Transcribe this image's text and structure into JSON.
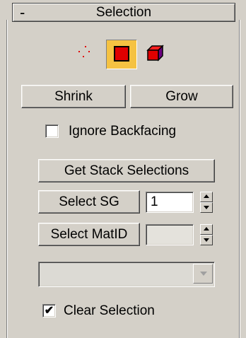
{
  "rollout": {
    "title": "Selection",
    "collapse_glyph": "-"
  },
  "selection_modes": [
    {
      "name": "vertex-mode-icon",
      "icon": "red-dots-vertex-icon",
      "active": false
    },
    {
      "name": "face-mode-icon",
      "icon": "red-square-face-icon",
      "active": true
    },
    {
      "name": "element-mode-icon",
      "icon": "red-cube-element-icon",
      "active": false
    }
  ],
  "buttons": {
    "shrink": "Shrink",
    "grow": "Grow",
    "get_stack_selections": "Get Stack Selections",
    "select_sg": "Select SG",
    "select_matid": "Select MatID"
  },
  "ignore_backfacing": {
    "label": "Ignore Backfacing",
    "checked": false
  },
  "select_sg_value": "1",
  "select_matid_value": "",
  "material_dropdown": {
    "selected": "",
    "enabled": false
  },
  "clear_selection": {
    "label": "Clear Selection",
    "checked": true,
    "check_glyph": "✔"
  },
  "colors": {
    "panel": "#d4d0c8",
    "active_highlight": "#f5c242",
    "icon_red": "#e00000"
  }
}
